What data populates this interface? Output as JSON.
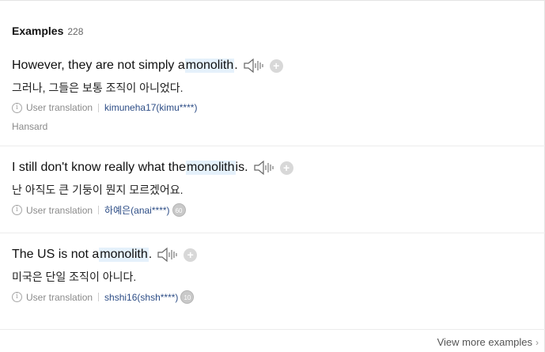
{
  "header": {
    "title": "Examples",
    "count": "228"
  },
  "examples": [
    {
      "before": "However, they are not simply a ",
      "keyword": "monolith",
      "after": ".",
      "translation": "그러나, 그들은 보통 조직이 아니었다.",
      "meta_label": "User translation",
      "user": "kimuneha17(kimu****)",
      "badge": "",
      "source": "Hansard"
    },
    {
      "before": "I still don't know really what the ",
      "keyword": "monolith",
      "after": " is.",
      "translation": "난 아직도 큰 기둥이 뭔지 모르겠어요.",
      "meta_label": "User translation",
      "user": "하예은(anai****)",
      "badge": "60",
      "source": ""
    },
    {
      "before": "The US is not a ",
      "keyword": "monolith",
      "after": ".",
      "translation": "미국은 단일 조직이 아니다.",
      "meta_label": "User translation",
      "user": "shshi16(shsh****)",
      "badge": "10",
      "source": ""
    }
  ],
  "footer": {
    "more_label": "View more examples"
  },
  "icons": {
    "speaker": "speaker-icon",
    "add": "plus-icon",
    "info": "info-icon",
    "more": "chevron-right-icon"
  }
}
